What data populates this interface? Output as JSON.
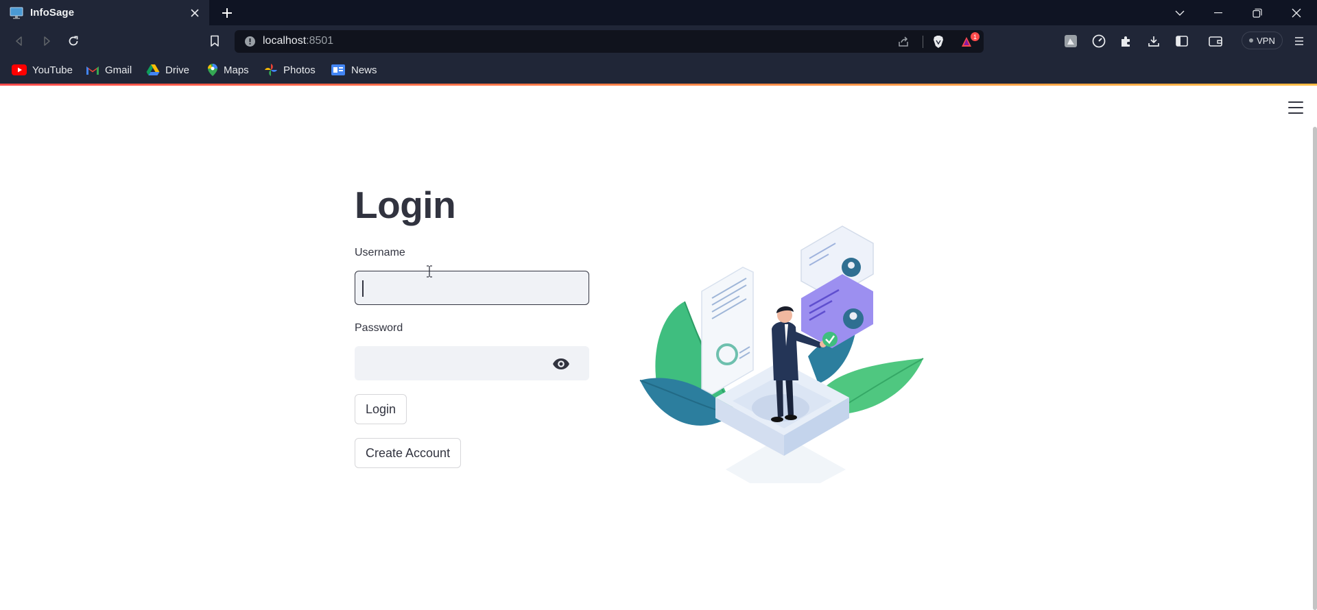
{
  "browser": {
    "tab_title": "InfoSage",
    "url_host": "localhost",
    "url_port": ":8501",
    "notification_count": "1",
    "vpn_label": "VPN",
    "bookmarks": [
      {
        "label": "YouTube",
        "icon": "youtube-icon"
      },
      {
        "label": "Gmail",
        "icon": "gmail-icon"
      },
      {
        "label": "Drive",
        "icon": "drive-icon"
      },
      {
        "label": "Maps",
        "icon": "maps-icon"
      },
      {
        "label": "Photos",
        "icon": "photos-icon"
      },
      {
        "label": "News",
        "icon": "news-icon"
      }
    ]
  },
  "login": {
    "title": "Login",
    "username_label": "Username",
    "username_value": "",
    "password_label": "Password",
    "password_value": "",
    "login_button": "Login",
    "create_account_button": "Create Account"
  },
  "colors": {
    "accent_gradient_start": "#ff4b4b",
    "accent_gradient_end": "#ffbd45",
    "text": "#31333f",
    "input_bg": "#f0f2f6"
  }
}
